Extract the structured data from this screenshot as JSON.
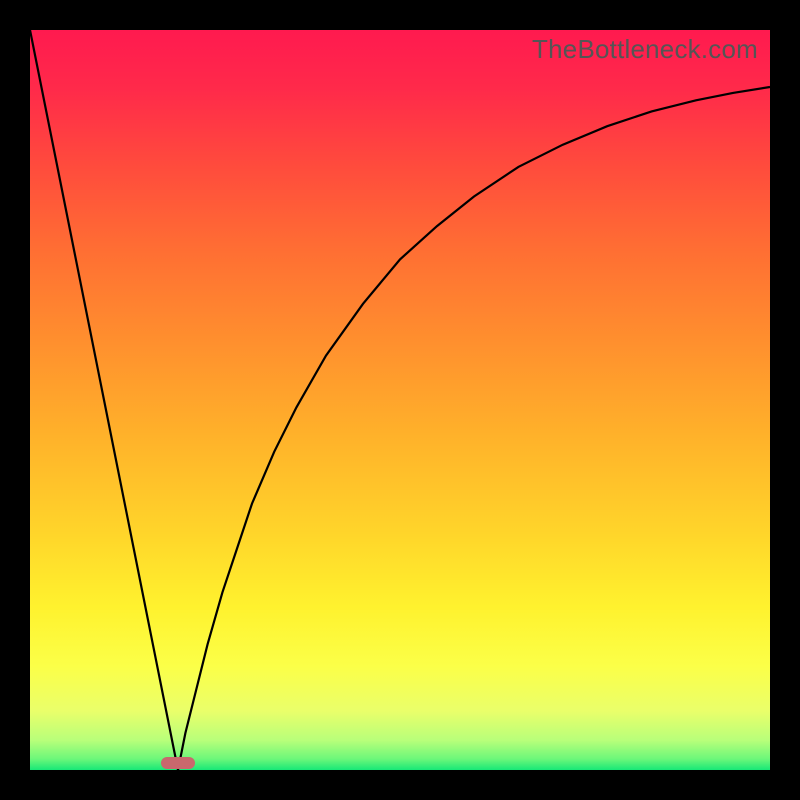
{
  "watermark": "TheBottleneck.com",
  "chart_data": {
    "type": "line",
    "title": "",
    "xlabel": "",
    "ylabel": "",
    "xlim": [
      0,
      100
    ],
    "ylim": [
      0,
      100
    ],
    "grid": false,
    "legend": false,
    "x": [
      0,
      2,
      4,
      6,
      8,
      10,
      12,
      14,
      16,
      18,
      19,
      19.5,
      20,
      20.5,
      21,
      22,
      24,
      26,
      28,
      30,
      33,
      36,
      40,
      45,
      50,
      55,
      60,
      66,
      72,
      78,
      84,
      90,
      95,
      100
    ],
    "y": [
      100,
      90,
      80,
      70,
      60,
      50,
      40,
      30,
      20,
      10,
      5,
      2.5,
      0,
      2.5,
      5,
      9,
      17,
      24,
      30,
      36,
      43,
      49,
      56,
      63,
      69,
      73.5,
      77.5,
      81.5,
      84.5,
      87,
      89,
      90.5,
      91.5,
      92.3
    ],
    "series": [
      {
        "name": "curve",
        "color": "#000000"
      }
    ],
    "background_gradient": {
      "stops": [
        {
          "offset": 0.0,
          "color": "#ff1a4f"
        },
        {
          "offset": 0.08,
          "color": "#ff2a4a"
        },
        {
          "offset": 0.18,
          "color": "#ff4a3d"
        },
        {
          "offset": 0.3,
          "color": "#ff6f33"
        },
        {
          "offset": 0.42,
          "color": "#ff8f2e"
        },
        {
          "offset": 0.55,
          "color": "#ffb22a"
        },
        {
          "offset": 0.68,
          "color": "#ffd52a"
        },
        {
          "offset": 0.78,
          "color": "#fff22e"
        },
        {
          "offset": 0.86,
          "color": "#fbff48"
        },
        {
          "offset": 0.92,
          "color": "#eaff6a"
        },
        {
          "offset": 0.96,
          "color": "#b8ff7a"
        },
        {
          "offset": 0.985,
          "color": "#6cf77a"
        },
        {
          "offset": 1.0,
          "color": "#17e877"
        }
      ]
    },
    "green_strip": {
      "y_start": 0.0,
      "y_end": 1.8,
      "color": "#17e877"
    },
    "marker": {
      "x": 20.0,
      "y": 0.9,
      "width_pct": 4.6,
      "height_pct": 1.6,
      "color": "#c9686d",
      "radius_px": 6
    }
  }
}
